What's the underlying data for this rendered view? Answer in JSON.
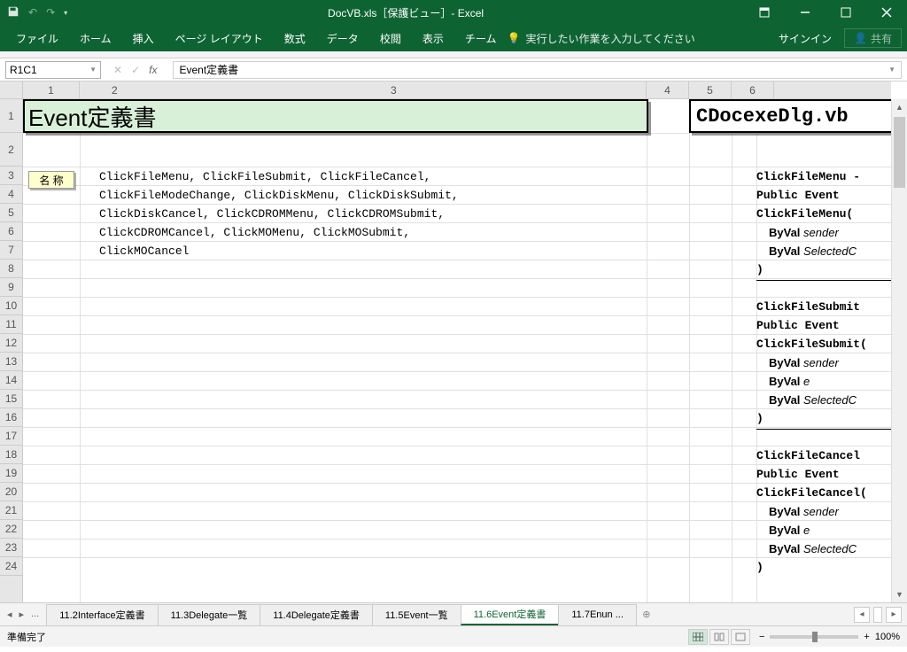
{
  "titlebar": {
    "title": "DocVB.xls［保護ビュー］- Excel"
  },
  "ribbon": {
    "file": "ファイル",
    "home": "ホーム",
    "insert": "挿入",
    "pagelayout": "ページ レイアウト",
    "formulas": "数式",
    "data": "データ",
    "review": "校閲",
    "view": "表示",
    "team": "チーム",
    "tellme_placeholder": "実行したい作業を入力してください",
    "signin": "サインイン",
    "share": "共有"
  },
  "namebox": "R1C1",
  "formula": "Event定義書",
  "columns": {
    "c1": "1",
    "c2": "2",
    "c3": "3",
    "c4": "4",
    "c5": "5",
    "c6": "6"
  },
  "rows": [
    "1",
    "2",
    "3",
    "4",
    "5",
    "6",
    "7",
    "8",
    "9",
    "10",
    "11",
    "12",
    "13",
    "14",
    "15",
    "16",
    "17",
    "18",
    "19",
    "20",
    "21",
    "22",
    "23",
    "24"
  ],
  "cells": {
    "title": "Event定義書",
    "filetitle": "CDocexeDlg.vb",
    "label_name": "名 称",
    "code": {
      "l3": "ClickFileMenu, ClickFileSubmit, ClickFileCancel,",
      "l4": "ClickFileModeChange, ClickDiskMenu, ClickDiskSubmit,",
      "l5": "ClickDiskCancel, ClickCDROMMenu, ClickCDROMSubmit,",
      "l6": "ClickCDROMCancel, ClickMOMenu, ClickMOSubmit,",
      "l7": "ClickMOCancel"
    },
    "right": {
      "r3": "ClickFileMenu -",
      "r4": "Public Event",
      "r5": "ClickFileMenu(",
      "r6a": "ByVal ",
      "r6b": "sender",
      "r7a": "ByVal ",
      "r7b": "SelectedC",
      "r8": ")",
      "r10": "ClickFileSubmit",
      "r11": "Public Event",
      "r12": "ClickFileSubmit(",
      "r13a": "ByVal ",
      "r13b": "sender",
      "r14a": "ByVal ",
      "r14b": "e",
      "r15a": "ByVal ",
      "r15b": "SelectedC",
      "r16": ")",
      "r18": "ClickFileCancel",
      "r19": "Public Event",
      "r20": "ClickFileCancel(",
      "r21a": "ByVal ",
      "r21b": "sender",
      "r22a": "ByVal ",
      "r22b": "e",
      "r23a": "ByVal ",
      "r23b": "SelectedC",
      "r24": ")"
    }
  },
  "sheet_tabs": {
    "nav_more": "...",
    "t1": "11.2Interface定義書",
    "t2": "11.3Delegate一覧",
    "t3": "11.4Delegate定義書",
    "t4": "11.5Event一覧",
    "t5": "11.6Event定義書",
    "t6": "11.7Enun",
    "t6_more": "..."
  },
  "statusbar": {
    "ready": "準備完了",
    "zoom": "100%"
  }
}
